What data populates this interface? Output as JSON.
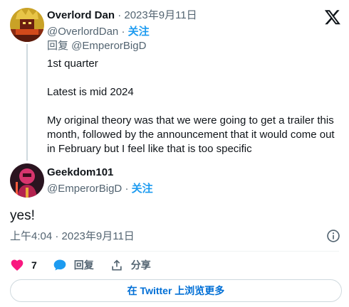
{
  "parent_tweet": {
    "author_name": "Overlord Dan",
    "separator": "·",
    "date": "2023年9月11日",
    "handle": "@OverlordDan",
    "follow_label": "关注",
    "reply_to": "回复 @EmperorBigD",
    "paragraphs": [
      "1st quarter",
      "Latest is mid 2024",
      "My original theory was that we were going to get a trailer this month, followed by the announcement that it would come out in February but I feel like that is too specific"
    ]
  },
  "main_tweet": {
    "author_name": "Geekdom101",
    "handle": "@EmperorBigD",
    "separator": "·",
    "follow_label": "关注",
    "text": "yes!",
    "timestamp": "上午4:04 · 2023年9月11日"
  },
  "actions": {
    "like_count": "7",
    "reply_label": "回复",
    "share_label": "分享"
  },
  "more_button_label": "在 Twitter 上浏览更多",
  "colors": {
    "accent": "#1d9bf0",
    "like": "#f91880",
    "link_button": "#006fd6",
    "secondary_text": "#536471"
  },
  "icons": [
    "x-logo-icon",
    "info-icon",
    "heart-icon",
    "reply-bubble-icon",
    "share-icon"
  ]
}
